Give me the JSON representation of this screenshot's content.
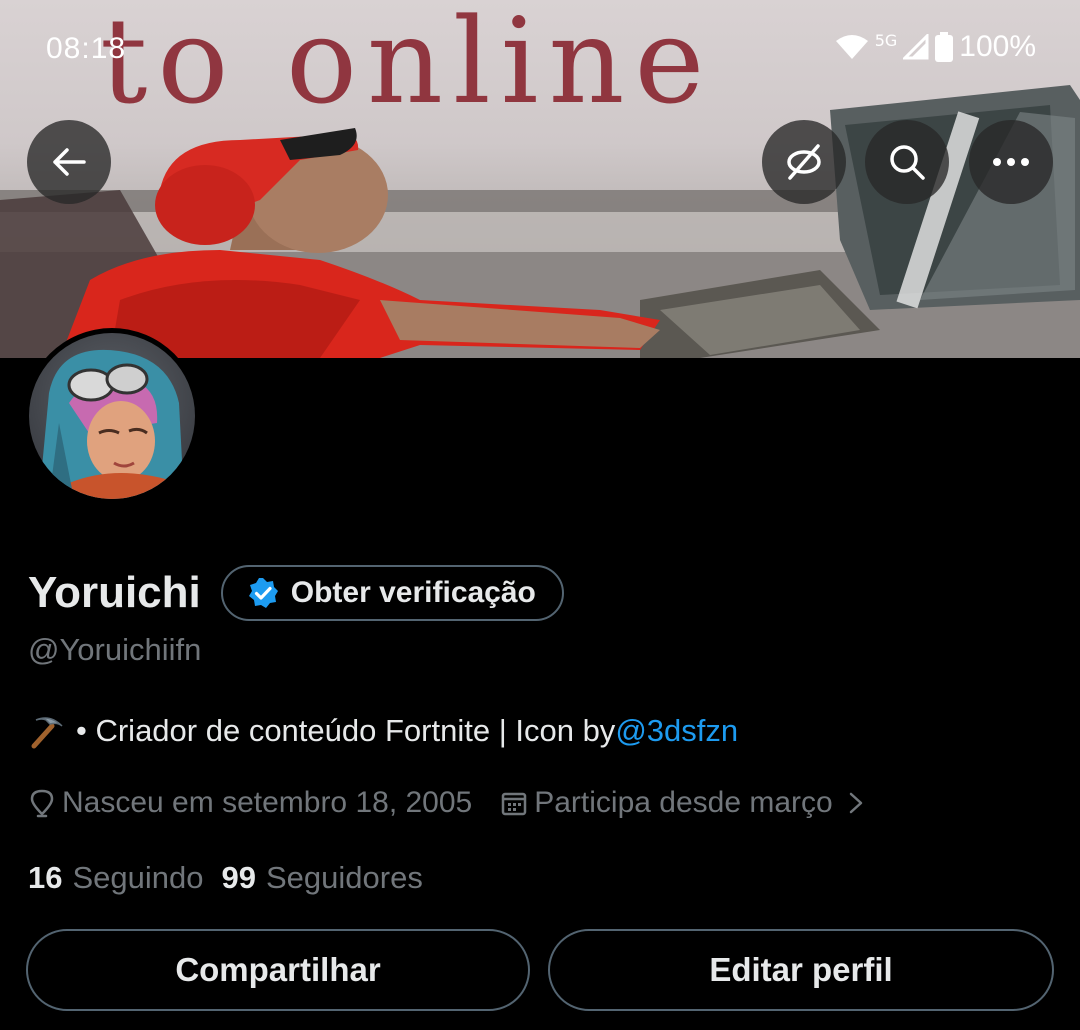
{
  "status_bar": {
    "time": "08:18",
    "network": "5G",
    "battery": "100%"
  },
  "banner": {
    "caption": "to online"
  },
  "icons": {
    "back": "arrow-left-icon",
    "offline": "offline-icon",
    "search": "search-icon",
    "more": "more-icon",
    "verified": "verified-badge-icon",
    "location": "location-pin-icon",
    "calendar": "calendar-icon",
    "chevron": "chevron-right-icon",
    "bio_emoji": "pickaxe-icon"
  },
  "profile": {
    "name": "Yoruichi",
    "verify_label": "Obter verificação",
    "handle": "@Yoruichiifn",
    "bio_text": "• Criador de conteúdo Fortnite | Icon by ",
    "bio_link": "@3dsfzn",
    "birth": "Nasceu em setembro 18, 2005",
    "joined": "Participa desde março",
    "following_count": "16",
    "following_label": "Seguindo",
    "followers_count": "99",
    "followers_label": "Seguidores"
  },
  "actions": {
    "share": "Compartilhar",
    "edit": "Editar perfil"
  },
  "colors": {
    "background": "#000000",
    "text_primary": "#e7e9ea",
    "text_secondary": "#71767b",
    "link": "#1d9bf0",
    "border": "#536471"
  }
}
